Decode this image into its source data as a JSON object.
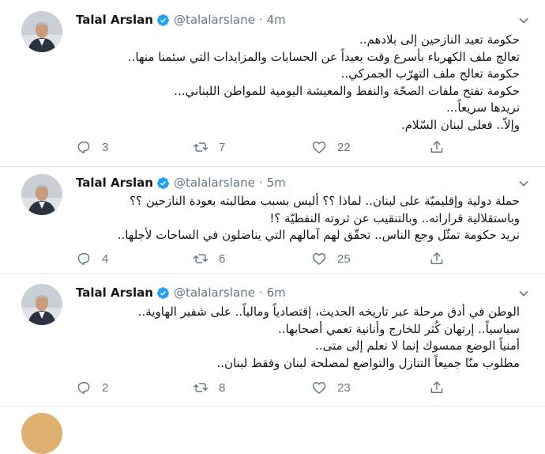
{
  "tweets": [
    {
      "name": "Talal Arslan",
      "handle": "@talalarslane",
      "time": "4m",
      "lines": [
        "حكومة تعيد النازحين إلى بلادهم..",
        "تعالج ملف الكهرباء بأسرع وقت بعيداً عن الحسابات والمزايدات التي سئمنا منها..",
        "حكومة تعالج ملف التهرّب الجمركي..",
        "حكومة تفتح ملفات الصحّة والنفط والمعيشة اليومية للمواطن اللبناني...",
        "نريدها سريعاً...",
        "وإلاّ.. فعلى لبنان السّلام."
      ],
      "replies": "3",
      "retweets": "7",
      "likes": "22"
    },
    {
      "name": "Talal Arslan",
      "handle": "@talalarslane",
      "time": "5m",
      "lines": [
        "حملة دولية وإقليميّة على لبنان.. لماذا ؟؟ أليس بسبب مطالبته بعودة النازحين ؟؟",
        "وباستقلالية قراراته.. وبالتنقيب عن ثروته النفطيّة ؟!",
        "نريد حكومة تمثّل وجع الناس.. تحقّق لهم آمالهم التي يناضلون في الساحات لأجلها.."
      ],
      "replies": "4",
      "retweets": "6",
      "likes": "25"
    },
    {
      "name": "Talal Arslan",
      "handle": "@talalarslane",
      "time": "6m",
      "lines": [
        "الوطن في أدق مرحلة عبر تاريخه الحديث، إقتصادياً ومالياً.. على شفير الهاوية..",
        "سياسياً.. إرتهان كُثر للخارج وأنانية تعمي أصحابها..",
        "أمنياً الوضع ممسوك إنما لا نعلم إلى متى..",
        "مطلوب منّا جميعاً التنازل والتواضع لمصلحة لبنان وفقط لبنان.."
      ],
      "replies": "2",
      "retweets": "8",
      "likes": "23"
    }
  ],
  "icons": {
    "verified": "verified-badge-icon",
    "caret": "chevron-down-icon",
    "reply": "reply-icon",
    "retweet": "retweet-icon",
    "like": "heart-icon",
    "share": "share-icon"
  },
  "colors": {
    "verified": "#1da1f2",
    "text": "#14171a",
    "muted": "#657786",
    "divider": "#e6ecf0"
  }
}
